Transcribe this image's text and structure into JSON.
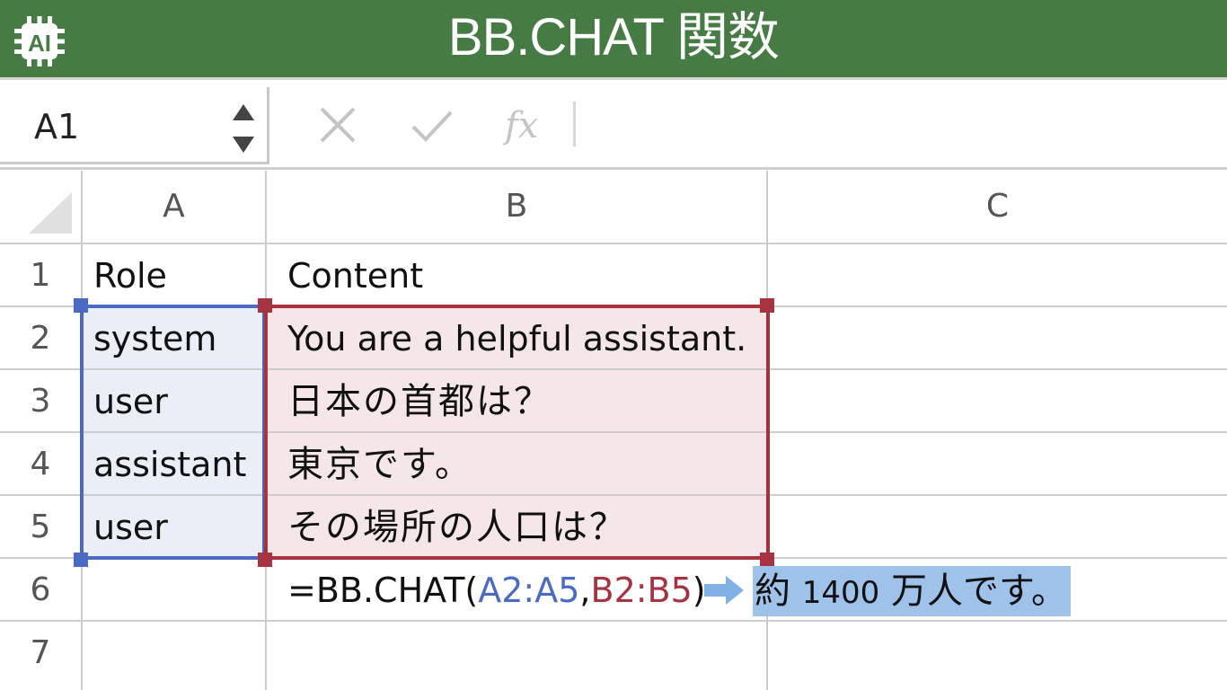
{
  "app": {
    "title": "BB.CHAT 関数",
    "logo_icon": "ai-chip-icon",
    "colors": {
      "titlebar": "#467c44",
      "range_a": "#4a6bc1",
      "range_b": "#a83340",
      "result_highlight": "#9fc2ea"
    }
  },
  "formula_bar": {
    "name_box": "A1",
    "cancel_icon": "close-icon",
    "enter_icon": "check-icon",
    "function_icon": "fx-icon",
    "formula": ""
  },
  "sheet": {
    "columns": [
      "A",
      "B",
      "C"
    ],
    "rows": [
      "1",
      "2",
      "3",
      "4",
      "5",
      "6",
      "7"
    ],
    "cells": {
      "A1": "Role",
      "B1": "Content",
      "A2": "system",
      "B2": "You are a helpful assistant.",
      "A3": "user",
      "B3": "日本の首都は？",
      "A4": "assistant",
      "B4": "東京です。",
      "A5": "user",
      "B5": "その場所の人口は？"
    },
    "formula_cell": {
      "prefix": "=BB.CHAT(",
      "arg1": "A2:A5",
      "comma": ",",
      "arg2": "B2:B5",
      "suffix": ")"
    },
    "result": {
      "part1": "約 ",
      "number": "1400",
      "part2": " 万人です。",
      "arrow_icon": "arrow-right-icon"
    }
  }
}
